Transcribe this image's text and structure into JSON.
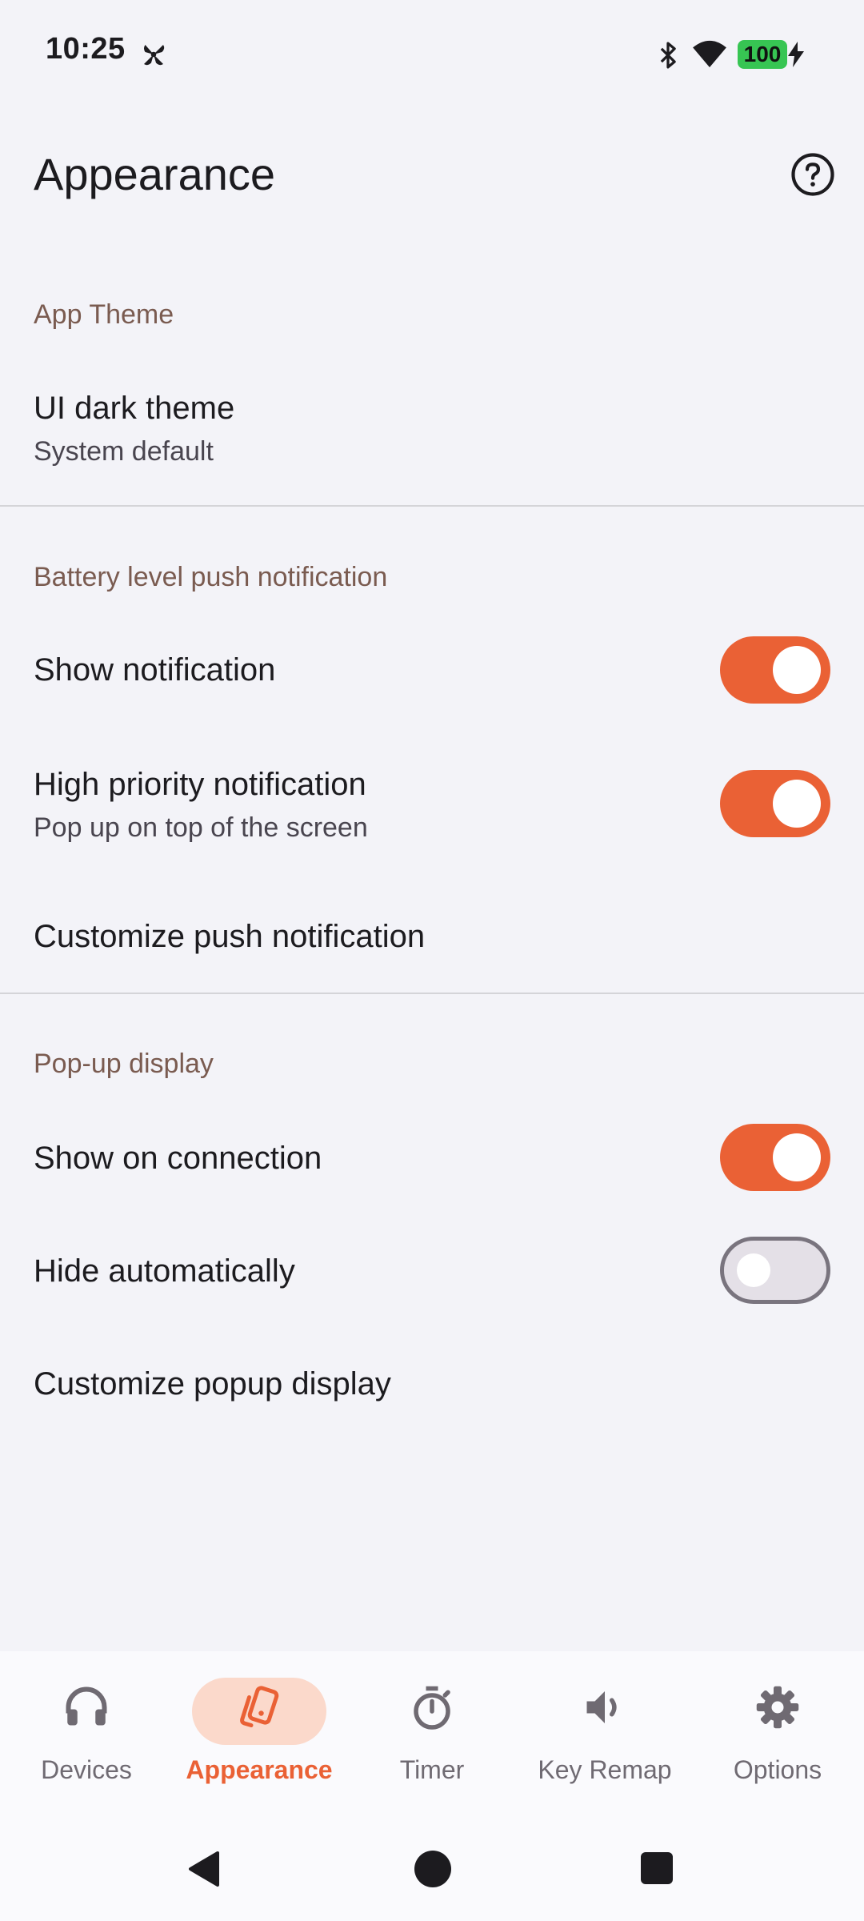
{
  "status_bar": {
    "time": "10:25",
    "battery_level": "100",
    "icons": [
      "fan-icon",
      "bluetooth-icon",
      "wifi-icon",
      "battery-icon",
      "charging-bolt-icon"
    ]
  },
  "app_bar": {
    "title": "Appearance",
    "help_icon": "help-circle-icon"
  },
  "sections": {
    "app_theme": {
      "header": "App Theme",
      "dark_theme": {
        "title": "UI dark theme",
        "subtitle": "System default"
      }
    },
    "battery_notification": {
      "header": "Battery level push notification",
      "show_notification": {
        "title": "Show notification",
        "enabled": true
      },
      "high_priority": {
        "title": "High priority notification",
        "subtitle": "Pop up on top of the screen",
        "enabled": true
      },
      "customize": {
        "title": "Customize push notification"
      }
    },
    "popup_display": {
      "header": "Pop-up display",
      "show_on_connection": {
        "title": "Show on connection",
        "enabled": true
      },
      "hide_automatically": {
        "title": "Hide automatically",
        "enabled": false
      },
      "customize": {
        "title": "Customize popup display"
      }
    }
  },
  "bottom_nav": {
    "items": [
      {
        "label": "Devices",
        "icon": "headphones-icon",
        "active": false
      },
      {
        "label": "Appearance",
        "icon": "appearance-cards-icon",
        "active": true
      },
      {
        "label": "Timer",
        "icon": "stopwatch-icon",
        "active": false
      },
      {
        "label": "Key Remap",
        "icon": "volume-icon",
        "active": false
      },
      {
        "label": "Options",
        "icon": "gear-icon",
        "active": false
      }
    ]
  },
  "colors": {
    "accent": "#ea6135",
    "active_pill": "#fbd9cb",
    "section_header": "#7a5b50",
    "background": "#f3f3f8",
    "battery_green": "#37c553"
  }
}
